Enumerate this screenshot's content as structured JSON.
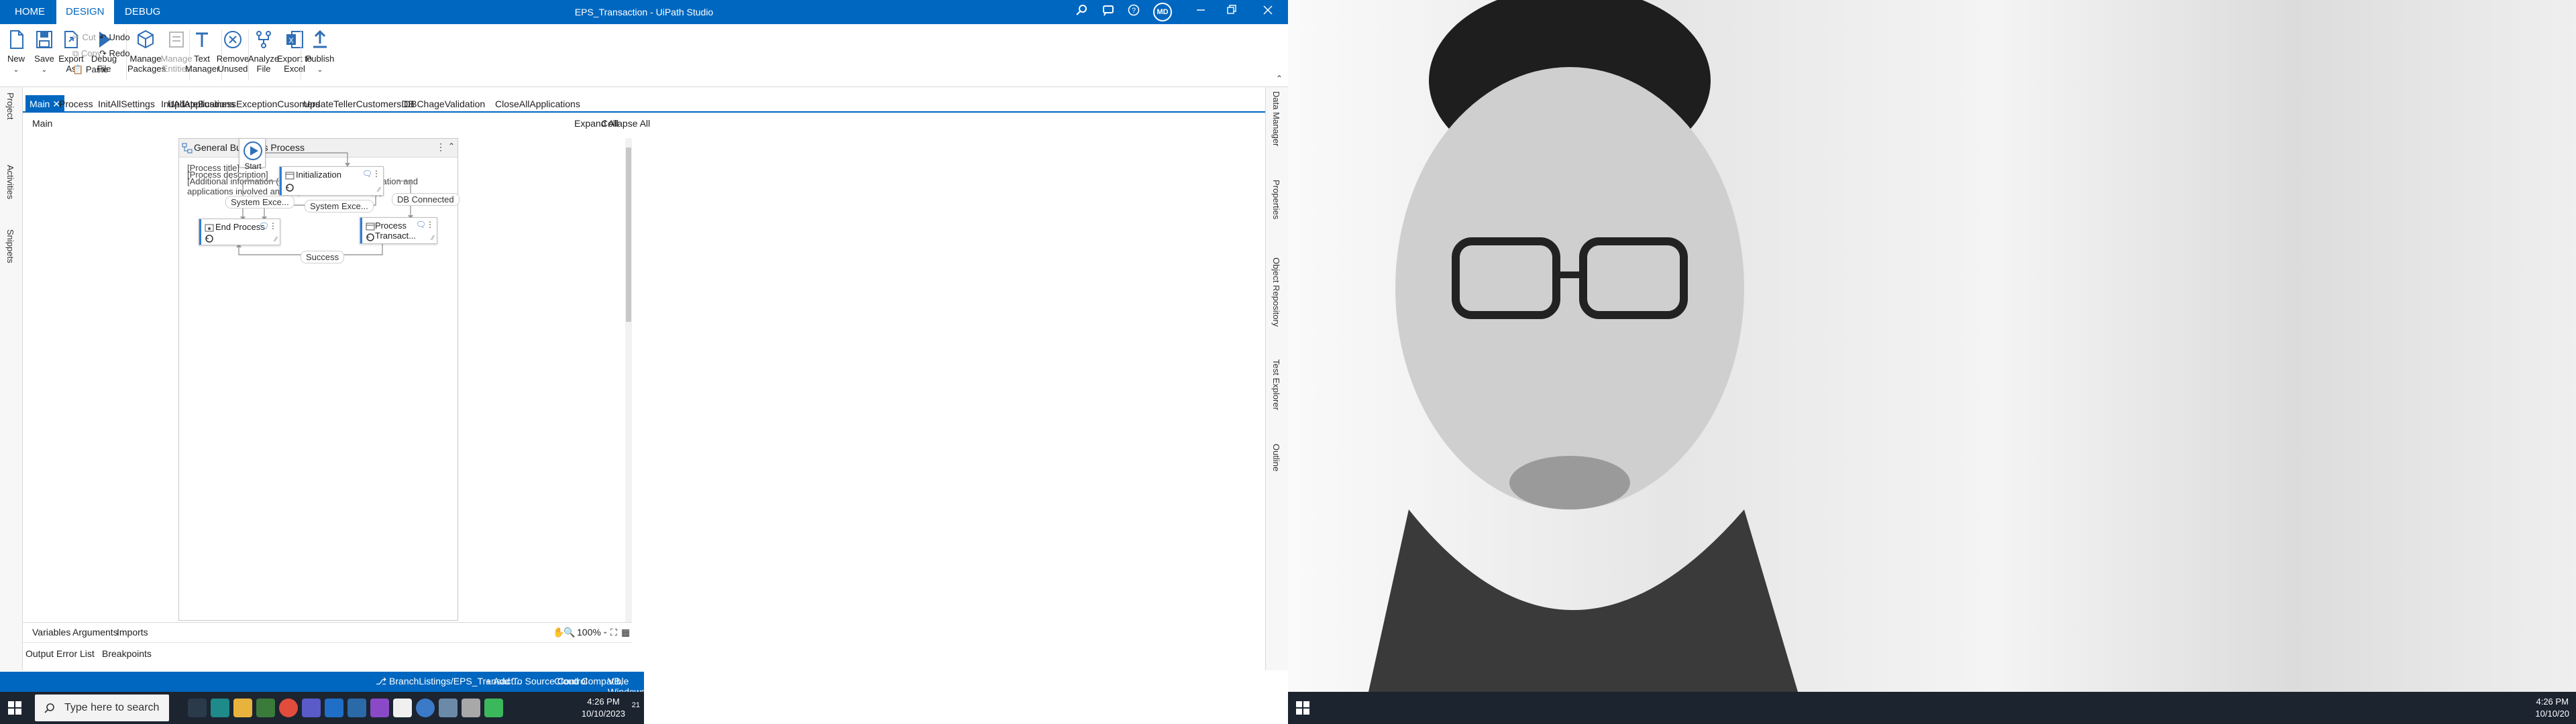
{
  "screenA": {
    "ribbon_tabs": [
      "HOME",
      "DESIGN",
      "DEBUG"
    ],
    "window_title": "EPS_Transaction - UiPath Studio",
    "user_initials": "MD",
    "ribbon": {
      "new": "New",
      "save": "Save",
      "export_as": "Export As",
      "debug_file": "Debug File",
      "cut": "Cut",
      "copy": "Copy",
      "paste": "Paste",
      "undo": "Undo",
      "redo": "Redo",
      "manage_packages": "Manage Packages",
      "manage_entities": "Manage Entities",
      "text_manager": "Text Manager",
      "remove_unused": "Remove Unused",
      "analyze_file": "Analyze File",
      "export_excel": "Export to Excel",
      "publish": "Publish"
    },
    "left_panels": [
      "Project",
      "Activities",
      "Snippets"
    ],
    "right_panels": [
      "Data Manager",
      "Properties",
      "Object Repository",
      "Test Explorer",
      "Outline"
    ],
    "doc_tabs": [
      "Main",
      "Process",
      "InitAllSettings",
      "InitAllApplications",
      "UpdateBusinessExceptionCusomers",
      "UpdateTellerCustomersDB",
      "DBChageValidation",
      "CloseAllApplications"
    ],
    "breadcrumb": "Main",
    "expand_all": "Expand All",
    "collapse_all": "Collapse All",
    "flow": {
      "title": "General Business Process",
      "annotations": [
        "[Process title]",
        "[Process description]",
        "[Additional information (e.g., author, contact information and applications involved and required external setup)]"
      ],
      "start_label": "Start",
      "nodes": {
        "initialization": "Initialization",
        "end_process": "End Process",
        "process_transaction": "Process Transact..."
      },
      "edges": {
        "system_exception_1": "System Exce...",
        "system_exception_2": "System Exce...",
        "db_connected": "DB Connected",
        "success": "Success"
      }
    },
    "bottom_tabs": [
      "Variables",
      "Arguments",
      "Imports"
    ],
    "zoom": "100%",
    "output_tabs": [
      "Output",
      "Error List",
      "Breakpoints"
    ],
    "status": {
      "branch": "BranchListings/EPS_Transact...",
      "source_control": "Add To Source Control",
      "compat": "Cloud Compatible",
      "framework": "VB, Windows"
    },
    "taskbar": {
      "search_placeholder": "Type here to search",
      "time": "4:26 PM",
      "date": "10/10/2023",
      "notif_count": "21"
    }
  },
  "screenB": {
    "time": "4:26 PM",
    "date": "10/10/20"
  },
  "colors": {
    "accent": "#0067c0",
    "taskbar": "#1c2430"
  }
}
